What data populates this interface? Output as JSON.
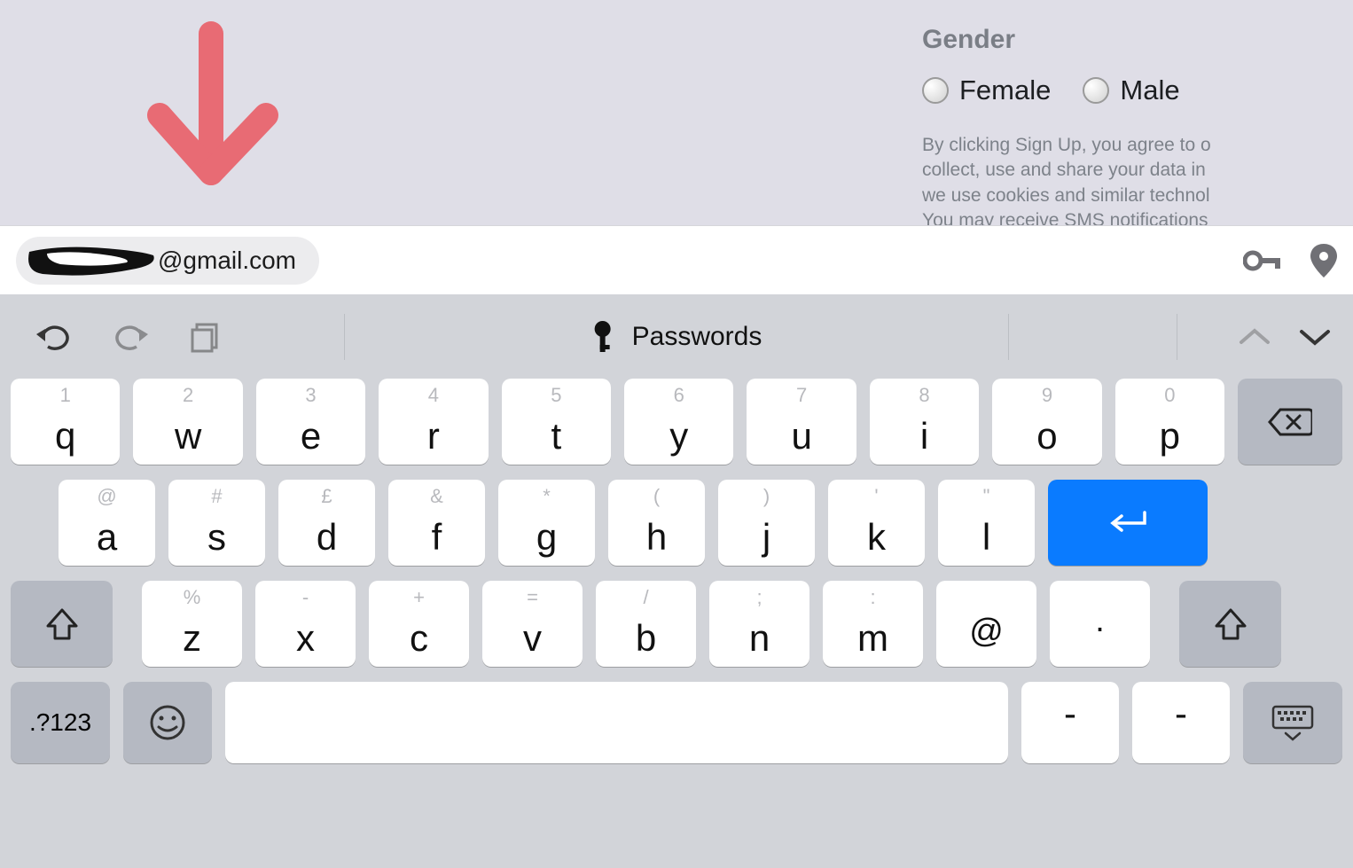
{
  "form": {
    "gender_label": "Gender",
    "female_label": "Female",
    "male_label": "Male",
    "terms_line1": "By clicking Sign Up, you agree to o",
    "terms_line2": "collect, use and share your data in",
    "terms_line3": "we use cookies and similar technol",
    "terms_line4": "You may receive SMS notifications"
  },
  "suggestion": {
    "email_visible": "@gmail.com"
  },
  "keyboard": {
    "passwords_label": "Passwords",
    "row1": [
      {
        "num": "1",
        "letter": "q"
      },
      {
        "num": "2",
        "letter": "w"
      },
      {
        "num": "3",
        "letter": "e"
      },
      {
        "num": "4",
        "letter": "r"
      },
      {
        "num": "5",
        "letter": "t"
      },
      {
        "num": "6",
        "letter": "y"
      },
      {
        "num": "7",
        "letter": "u"
      },
      {
        "num": "8",
        "letter": "i"
      },
      {
        "num": "9",
        "letter": "o"
      },
      {
        "num": "0",
        "letter": "p"
      }
    ],
    "row2": [
      {
        "num": "@",
        "letter": "a"
      },
      {
        "num": "#",
        "letter": "s"
      },
      {
        "num": "£",
        "letter": "d"
      },
      {
        "num": "&",
        "letter": "f"
      },
      {
        "num": "*",
        "letter": "g"
      },
      {
        "num": "(",
        "letter": "h"
      },
      {
        "num": ")",
        "letter": "j"
      },
      {
        "num": "'",
        "letter": "k"
      },
      {
        "num": "\"",
        "letter": "l"
      }
    ],
    "row3": [
      {
        "num": "%",
        "letter": "z"
      },
      {
        "num": "-",
        "letter": "x"
      },
      {
        "num": "+",
        "letter": "c"
      },
      {
        "num": "=",
        "letter": "v"
      },
      {
        "num": "/",
        "letter": "b"
      },
      {
        "num": ";",
        "letter": "n"
      },
      {
        "num": ":",
        "letter": "m"
      }
    ],
    "at_label": "@",
    "dot_label": ".",
    "numsym_label": ".?123",
    "dash_label": "-"
  }
}
